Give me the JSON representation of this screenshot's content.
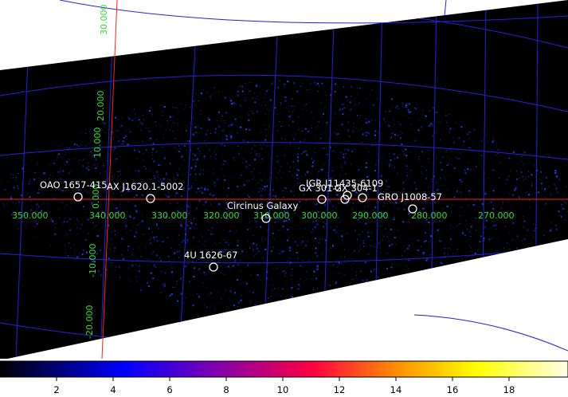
{
  "map": {
    "colors": {
      "background": "#000000",
      "outside": "#ffffff",
      "grid": "#2222dd",
      "crosshair": "#ff2020",
      "grid_labels": "#33dd33",
      "source_markers": "#ffffff",
      "noise": "#1a2fcf"
    },
    "longitude_labels": [
      "350.000",
      "340.000",
      "330.000",
      "320.000",
      "310.000",
      "300.000",
      "290.000",
      "280.000",
      "270.000"
    ],
    "latitude_labels": [
      "30.000",
      "20.000",
      "10.000",
      "0.000",
      "-10.000",
      "-20.000"
    ],
    "sources": [
      {
        "name": "OAO 1657-415"
      },
      {
        "name": "AX J1620.1-5002"
      },
      {
        "name": "IGR J11435-6109"
      },
      {
        "name": "GX 301-2"
      },
      {
        "name": "GX 304-1"
      },
      {
        "name": "GRO J1008-57"
      },
      {
        "name": "Circinus Galaxy"
      },
      {
        "name": "4U 1626-67"
      }
    ]
  },
  "colorbar": {
    "ticks": [
      "2",
      "4",
      "6",
      "8",
      "10",
      "12",
      "14",
      "16",
      "18"
    ],
    "gradient": [
      "#000000",
      "#0000ff",
      "#8000b0",
      "#ff0040",
      "#ff9000",
      "#ffff00",
      "#ffffe8"
    ]
  }
}
